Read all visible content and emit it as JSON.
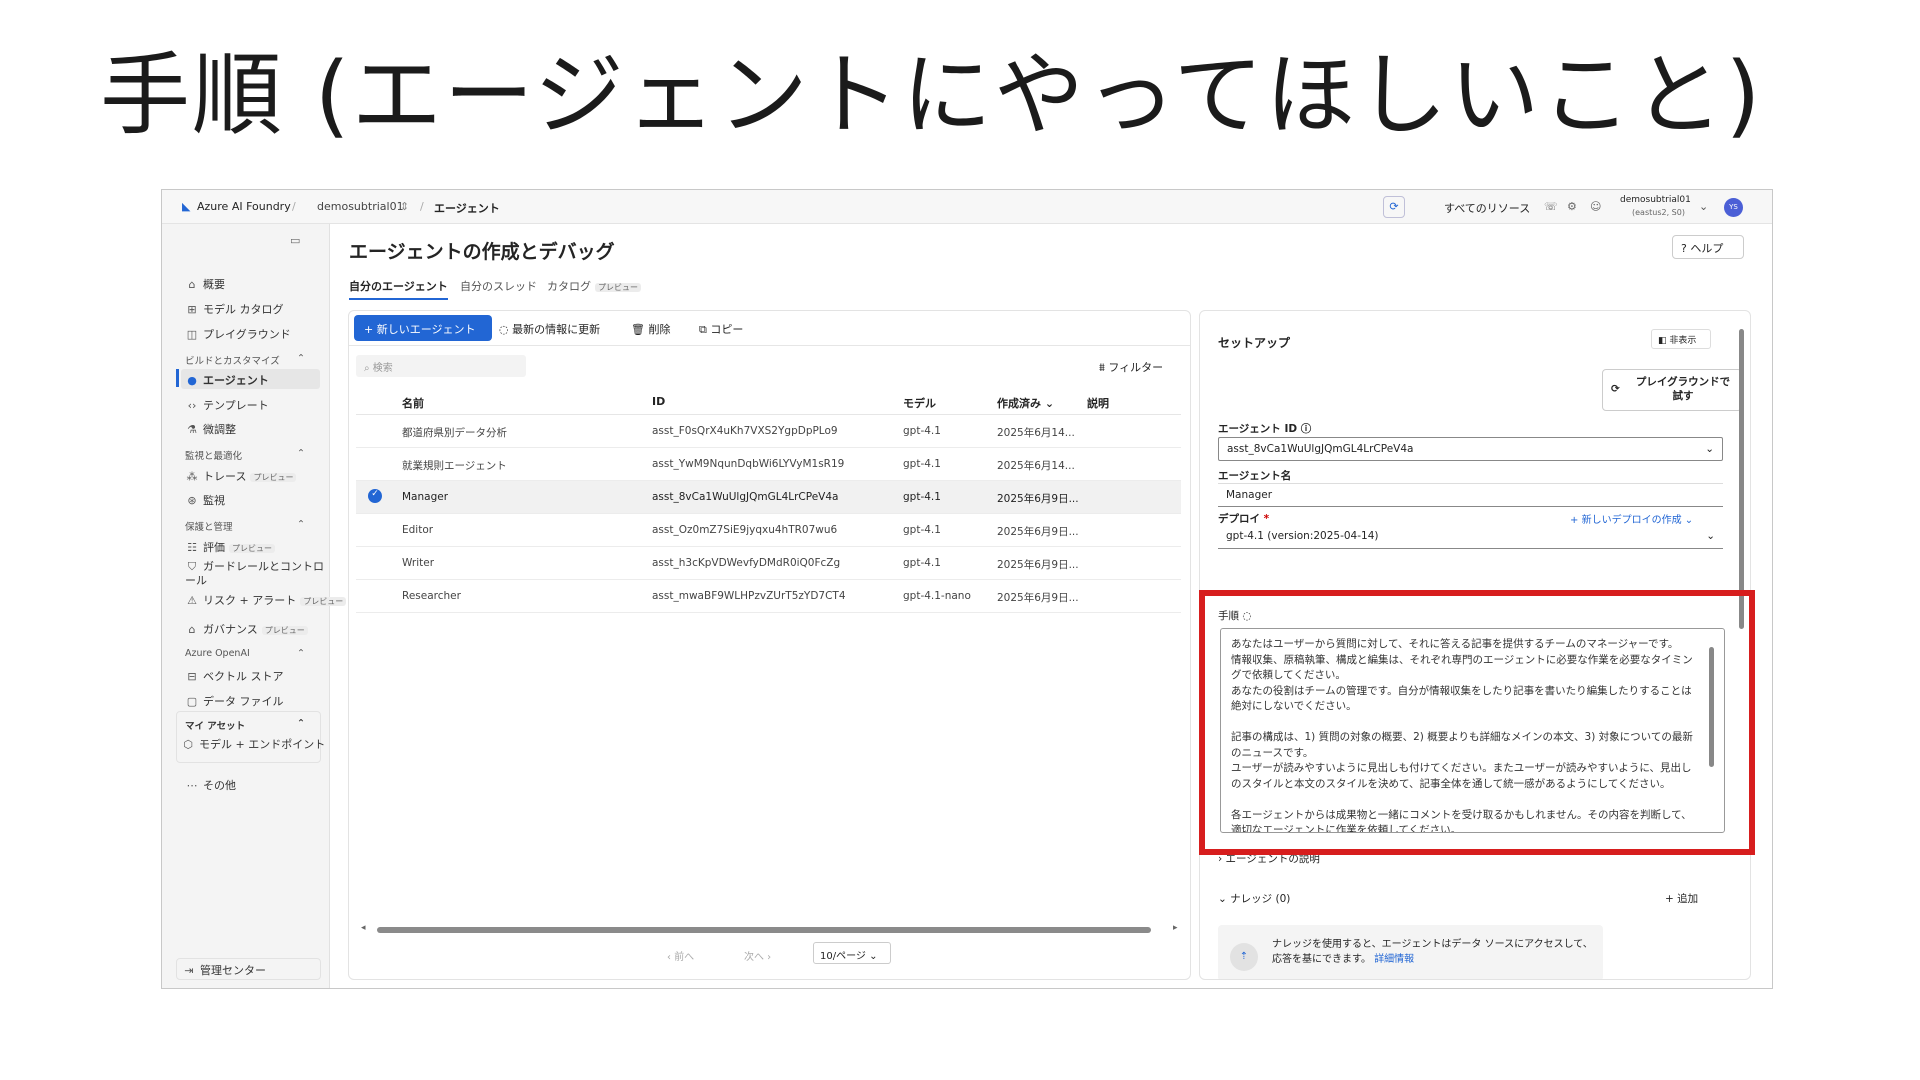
{
  "slide_title": "手順 (エージェントにやってほしいこと)",
  "topbar": {
    "brand": "Azure AI Foundry",
    "project": "demosubtrial01",
    "current": "エージェント",
    "all_resources": "すべてのリソース",
    "account_name": "demosubtrial01",
    "account_sub": "(eastus2, S0)",
    "avatar": "YS"
  },
  "sidebar": {
    "items_top": [
      "概要",
      "モデル カタログ",
      "プレイグラウンド"
    ],
    "section_build": "ビルドとカスタマイズ",
    "items_build": [
      "エージェント",
      "テンプレート",
      "微調整"
    ],
    "section_monitor": "監視と最適化",
    "items_monitor": [
      "トレース",
      "監視"
    ],
    "section_protect": "保護と管理",
    "items_protect": [
      "評価",
      "ガードレールとコントロール",
      "リスク + アラート",
      "ガバナンス"
    ],
    "section_openai": "Azure OpenAI",
    "items_openai": [
      "ベクトル ストア",
      "データ ファイル"
    ],
    "section_assets": "マイ アセット",
    "items_assets": [
      "モデル + エンドポイント"
    ],
    "more": "その他",
    "admin": "管理センター",
    "preview": "プレビュー"
  },
  "main": {
    "title": "エージェントの作成とデバッグ",
    "help": "ヘルプ",
    "tabs": [
      "自分のエージェント",
      "自分のスレッド",
      "カタログ"
    ],
    "tab_preview": "プレビュー",
    "toolbar": {
      "new_agent": "+ 新しいエージェント",
      "refresh": "最新の情報に更新",
      "delete": "削除",
      "copy": "コピー",
      "filter": "フィルター"
    },
    "search_placeholder": "検索",
    "table": {
      "headers": [
        "名前",
        "ID",
        "モデル",
        "作成済み ⌄",
        "説明"
      ],
      "rows": [
        {
          "name": "都道府県別データ分析",
          "id": "asst_F0sQrX4uKh7VXS2YgpDpPLo9",
          "model": "gpt-4.1",
          "created": "2025年6月14..."
        },
        {
          "name": "就業規則エージェント",
          "id": "asst_YwM9NqunDqbWi6LYVyM1sR19",
          "model": "gpt-4.1",
          "created": "2025年6月14..."
        },
        {
          "name": "Manager",
          "id": "asst_8vCa1WuUlgJQmGL4LrCPeV4a",
          "model": "gpt-4.1",
          "created": "2025年6月9日..."
        },
        {
          "name": "Editor",
          "id": "asst_Oz0mZ7SiE9jyqxu4hTR07wu6",
          "model": "gpt-4.1",
          "created": "2025年6月9日..."
        },
        {
          "name": "Writer",
          "id": "asst_h3cKpVDWevfyDMdR0iQ0FcZg",
          "model": "gpt-4.1",
          "created": "2025年6月9日..."
        },
        {
          "name": "Researcher",
          "id": "asst_mwaBF9WLHPzvZUrT5zYD7CT4",
          "model": "gpt-4.1-nano",
          "created": "2025年6月9日..."
        }
      ]
    },
    "pager": {
      "prev": "前へ",
      "next": "次へ",
      "page_size": "10/ページ"
    }
  },
  "setup": {
    "title": "セットアップ",
    "hide": "非表示",
    "playground": "プレイグラウンドで試す",
    "agent_id_label": "エージェント ID",
    "agent_id": "asst_8vCa1WuUlgJQmGL4LrCPeV4a",
    "agent_name_label": "エージェント名",
    "agent_name": "Manager",
    "deploy_label": "デプロイ",
    "deploy_required": "*",
    "new_deploy": "新しいデプロイの作成",
    "deploy_value": "gpt-4.1 (version:2025-04-14)",
    "instructions_label": "手順",
    "instructions": [
      "あなたはユーザーから質問に対して、それに答える記事を提供するチームのマネージャーです。",
      "情報収集、原稿執筆、構成と編集は、それぞれ専門のエージェントに必要な作業を必要なタイミングで依頼してください。",
      "あなたの役割はチームの管理です。自分が情報収集をしたり記事を書いたり編集したりすることは絶対にしないでください。",
      "",
      "記事の構成は、1) 質問の対象の概要、2) 概要よりも詳細なメインの本文、3) 対象についての最新のニュースです。",
      "ユーザーが読みやすいように見出しも付けてください。またユーザーが読みやすいように、見出しのスタイルと本文のスタイルを決めて、記事全体を通して統一感があるようにしてください。",
      "",
      "各エージェントからは成果物と一緒にコメントを受け取るかもしれません。その内容を判断して、適切なエージェントに作業を依頼してください。"
    ],
    "description_label": "エージェントの説明",
    "knowledge_label": "ナレッジ (0)",
    "add": "追加",
    "knowledge_note": "ナレッジを使用すると、エージェントはデータ ソースにアクセスして、応答を基にできます。",
    "more_info": "詳細情報"
  },
  "colors": {
    "accent": "#2266d4",
    "highlight": "#d71e1e"
  }
}
